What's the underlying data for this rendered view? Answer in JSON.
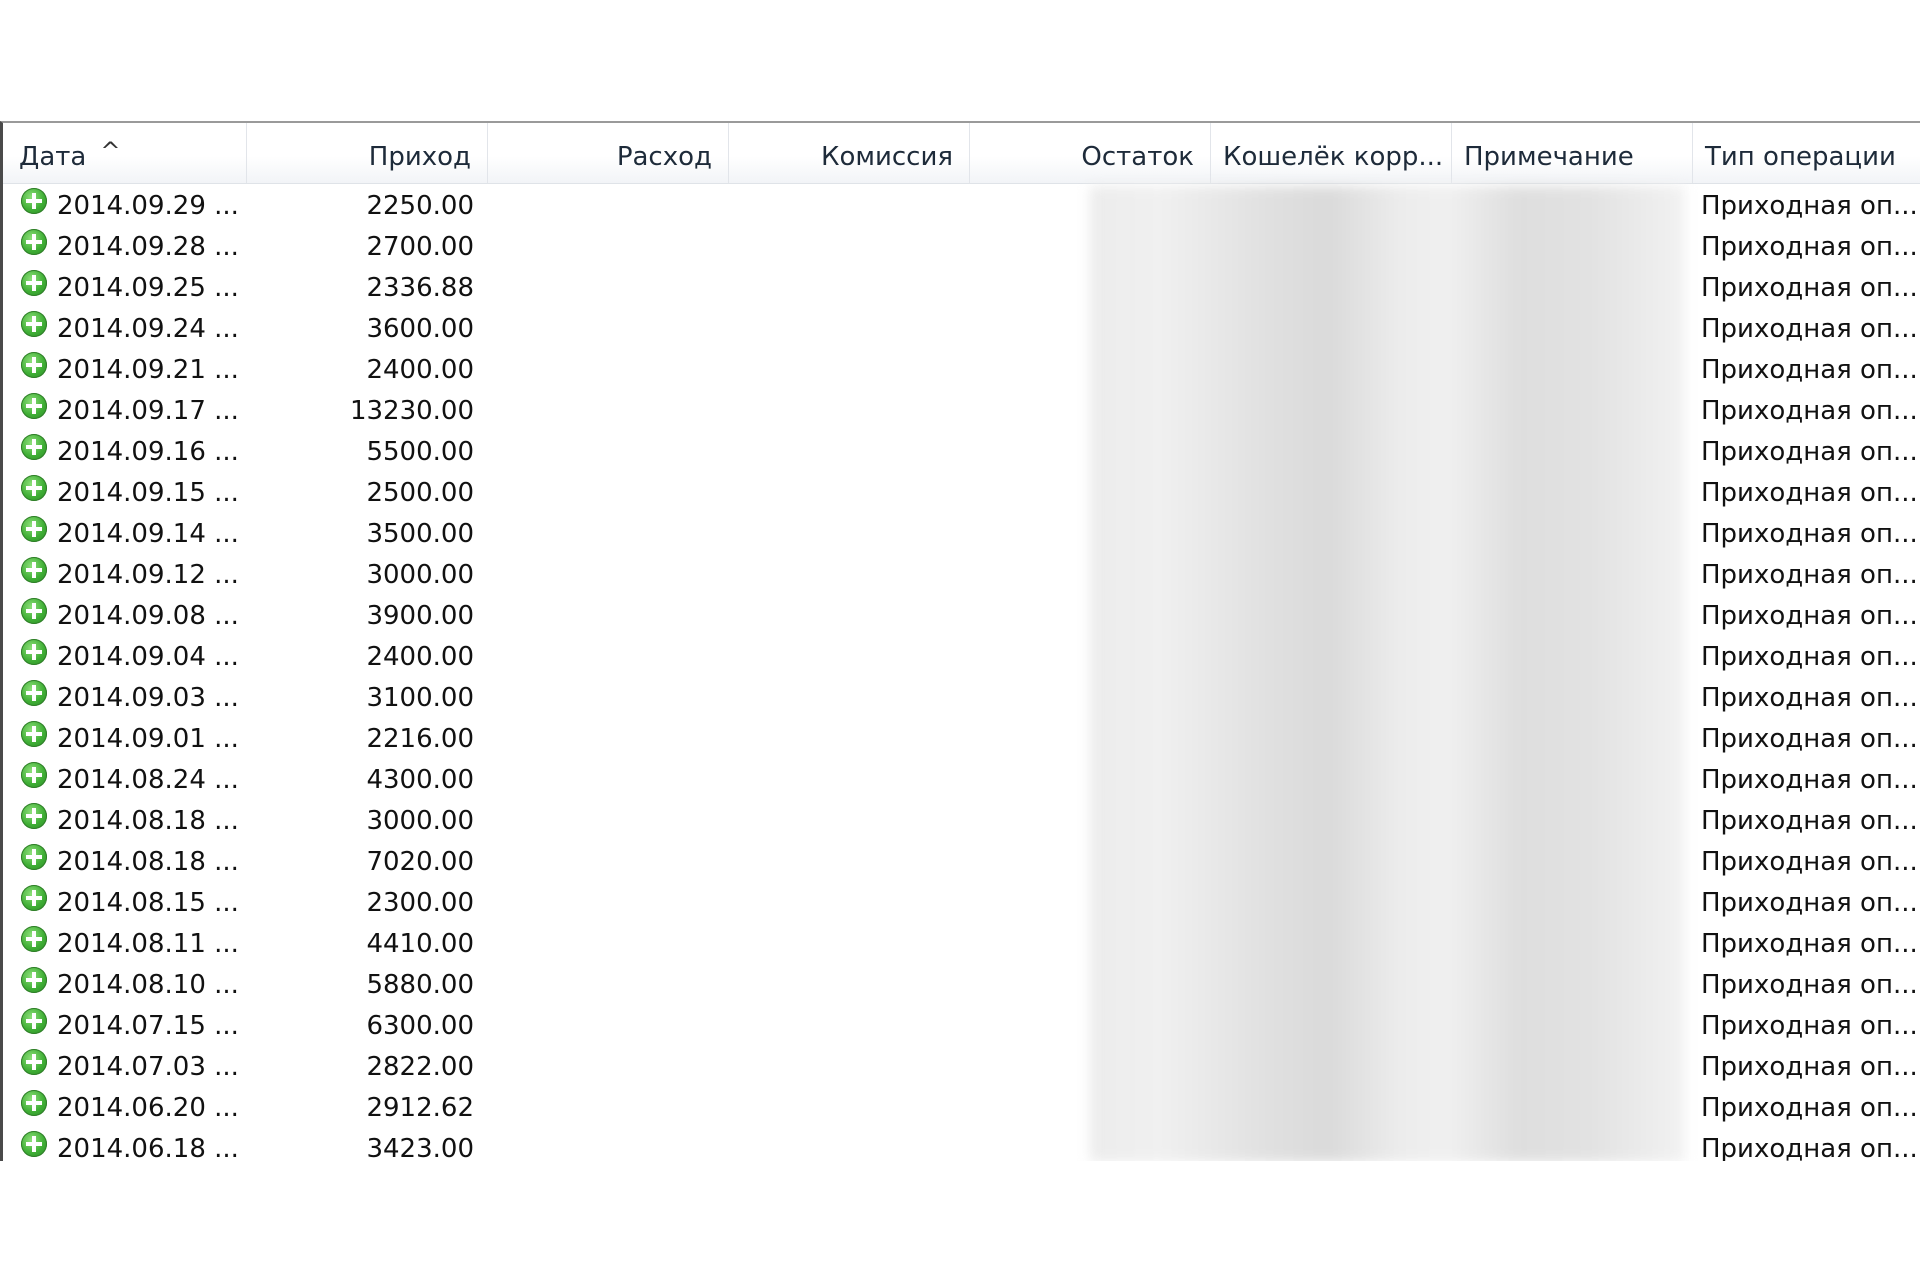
{
  "columns": [
    {
      "label": "Дата",
      "sort": "^"
    },
    {
      "label": "Приход"
    },
    {
      "label": "Расход"
    },
    {
      "label": "Комиссия"
    },
    {
      "label": "Остаток"
    },
    {
      "label": "Кошелёк корр..."
    },
    {
      "label": "Примечание"
    },
    {
      "label": "Тип операции"
    }
  ],
  "rows": [
    {
      "date": "2014.09.29 ...",
      "income": "2250.00",
      "type": "Приходная оп..."
    },
    {
      "date": "2014.09.28 ...",
      "income": "2700.00",
      "type": "Приходная оп..."
    },
    {
      "date": "2014.09.25 ...",
      "income": "2336.88",
      "type": "Приходная оп..."
    },
    {
      "date": "2014.09.24 ...",
      "income": "3600.00",
      "type": "Приходная оп..."
    },
    {
      "date": "2014.09.21 ...",
      "income": "2400.00",
      "type": "Приходная оп..."
    },
    {
      "date": "2014.09.17 ...",
      "income": "13230.00",
      "type": "Приходная оп..."
    },
    {
      "date": "2014.09.16 ...",
      "income": "5500.00",
      "type": "Приходная оп..."
    },
    {
      "date": "2014.09.15 ...",
      "income": "2500.00",
      "type": "Приходная оп..."
    },
    {
      "date": "2014.09.14 ...",
      "income": "3500.00",
      "type": "Приходная оп..."
    },
    {
      "date": "2014.09.12 ...",
      "income": "3000.00",
      "type": "Приходная оп..."
    },
    {
      "date": "2014.09.08 ...",
      "income": "3900.00",
      "type": "Приходная оп..."
    },
    {
      "date": "2014.09.04 ...",
      "income": "2400.00",
      "type": "Приходная оп..."
    },
    {
      "date": "2014.09.03 ...",
      "income": "3100.00",
      "type": "Приходная оп..."
    },
    {
      "date": "2014.09.01 ...",
      "income": "2216.00",
      "type": "Приходная оп..."
    },
    {
      "date": "2014.08.24 ...",
      "income": "4300.00",
      "type": "Приходная оп..."
    },
    {
      "date": "2014.08.18 ...",
      "income": "3000.00",
      "type": "Приходная оп..."
    },
    {
      "date": "2014.08.18 ...",
      "income": "7020.00",
      "type": "Приходная оп..."
    },
    {
      "date": "2014.08.15 ...",
      "income": "2300.00",
      "type": "Приходная оп..."
    },
    {
      "date": "2014.08.11 ...",
      "income": "4410.00",
      "type": "Приходная оп..."
    },
    {
      "date": "2014.08.10 ...",
      "income": "5880.00",
      "type": "Приходная оп..."
    },
    {
      "date": "2014.07.15 ...",
      "income": "6300.00",
      "type": "Приходная оп..."
    },
    {
      "date": "2014.07.03 ...",
      "income": "2822.00",
      "type": "Приходная оп..."
    },
    {
      "date": "2014.06.20 ...",
      "income": "2912.62",
      "type": "Приходная оп..."
    },
    {
      "date": "2014.06.18 ...",
      "income": "3423.00",
      "type": "Приходная оп..."
    }
  ],
  "icons": {
    "row_status": "plus-circle-icon"
  }
}
